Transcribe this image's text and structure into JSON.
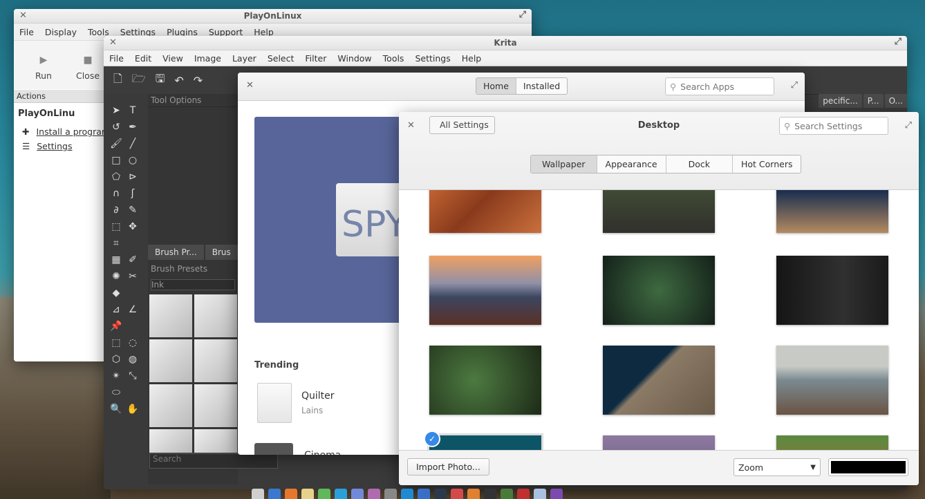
{
  "playonlinux": {
    "title": "PlayOnLinux",
    "menu": [
      "File",
      "Display",
      "Tools",
      "Settings",
      "Plugins",
      "Support",
      "Help"
    ],
    "toolbar": {
      "run": "Run",
      "close": "Close"
    },
    "actions_header": "Actions",
    "app_title": "PlayOnLinu",
    "links": {
      "install": "Install a program",
      "settings": "Settings"
    }
  },
  "krita": {
    "title": "Krita",
    "menu": [
      "File",
      "Edit",
      "View",
      "Image",
      "Layer",
      "Select",
      "Filter",
      "Window",
      "Tools",
      "Settings",
      "Help"
    ],
    "tool_options": "Tool Options",
    "tabs": [
      "Brush Pr...",
      "Brus"
    ],
    "brush_presets": "Brush Presets",
    "preset_filter": "Ink",
    "search_placeholder": "Search",
    "right_tabs": [
      "pecific...",
      "P...",
      "O..."
    ]
  },
  "appcenter": {
    "tabs": [
      "Home",
      "Installed"
    ],
    "search_placeholder": "Search Apps",
    "banner_text": "SPY",
    "trending": "Trending",
    "app": {
      "name": "Quilter",
      "developer": "Lains"
    },
    "next_app": "Cinema"
  },
  "settings": {
    "back": "All Settings",
    "title": "Desktop",
    "search_placeholder": "Search Settings",
    "tabs": [
      "Wallpaper",
      "Appearance",
      "Dock",
      "Hot Corners"
    ],
    "active_tab": "Wallpaper",
    "import_button": "Import Photo...",
    "mode": "Zoom",
    "color": "#000000"
  }
}
